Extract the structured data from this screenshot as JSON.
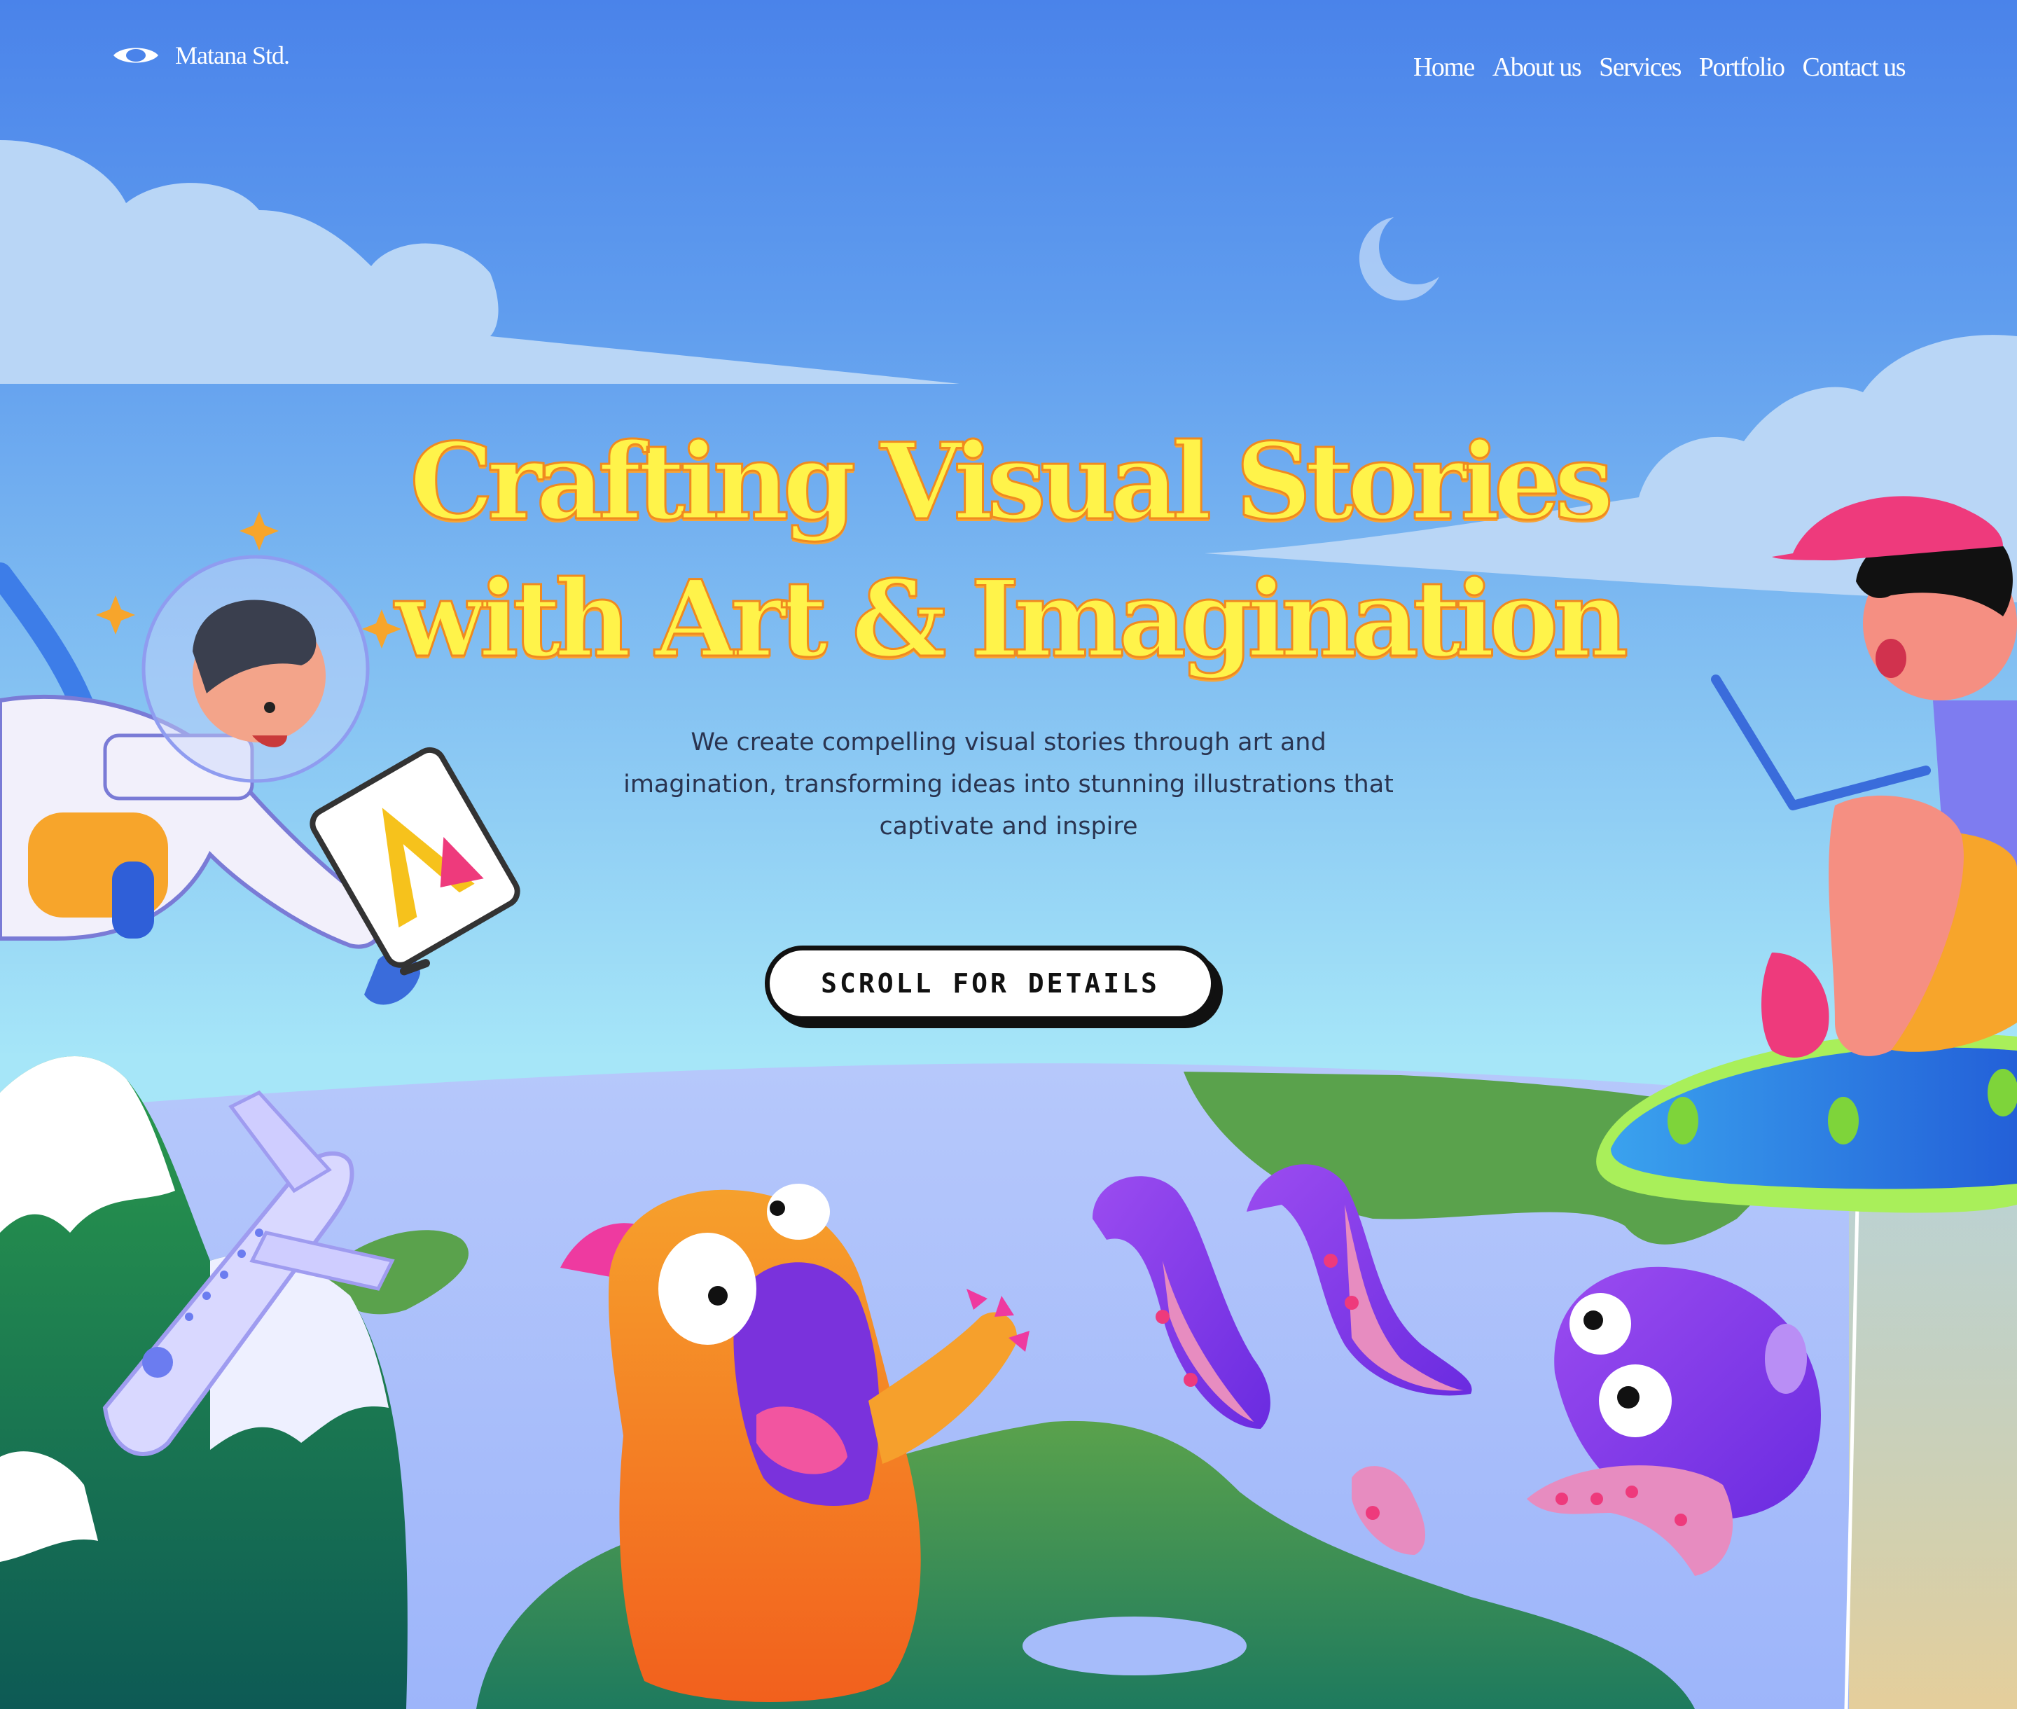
{
  "brand": {
    "name": "Matana Std.",
    "logo_icon": "eye-logo-icon"
  },
  "nav": {
    "links": [
      "Home",
      "About us",
      "Services",
      "Portfolio",
      "Contact us"
    ]
  },
  "hero": {
    "headline_line1": "Crafting Visual Stories",
    "headline_line2": "with Art & Imagination",
    "subtitle": "We create compelling visual stories through art and imagination, transforming ideas into stunning illustrations that captivate and inspire",
    "cta_label": "SCROLL FOR DETAILS"
  },
  "colors": {
    "sky_top": "#4a83ea",
    "sky_bottom": "#a8e6f8",
    "headline_fill": "#fff34a",
    "headline_outline": "#f08a1f",
    "cta_border": "#111111"
  },
  "illustration": {
    "elements": [
      "cloud-icon",
      "moon-icon",
      "astronaut-icon",
      "tablet-icon",
      "airplane-icon",
      "mountain-icon",
      "monster-icon",
      "tentacle-icon",
      "octopus-icon",
      "ufo-icon",
      "boy-with-laptop-icon",
      "island-icon"
    ]
  }
}
